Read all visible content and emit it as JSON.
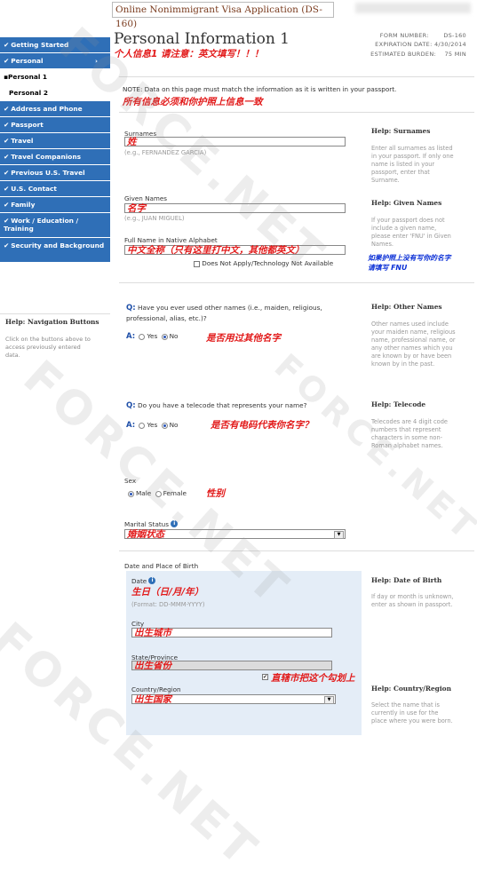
{
  "app_title": "Online Nonimmigrant Visa Application (DS-160)",
  "page_title": "Personal Information 1",
  "form_meta": {
    "form_number_label": "FORM NUMBER:",
    "form_number": "DS-160",
    "expiration_label": "EXPIRATION DATE:",
    "expiration": "4/30/2014",
    "burden_label": "ESTIMATED BURDEN:",
    "burden": "75 MIN"
  },
  "sidebar": {
    "items": [
      {
        "label": "Getting Started"
      },
      {
        "label": "Personal",
        "arrow": "›"
      },
      {
        "label": "Personal 1"
      },
      {
        "label": "Personal 2"
      },
      {
        "label": "Address and Phone"
      },
      {
        "label": "Passport"
      },
      {
        "label": "Travel"
      },
      {
        "label": "Travel Companions"
      },
      {
        "label": "Previous U.S. Travel"
      },
      {
        "label": "U.S. Contact"
      },
      {
        "label": "Family"
      },
      {
        "label": "Work / Education / Training"
      },
      {
        "label": "Security and Background"
      }
    ],
    "help_title": "Help: Navigation Buttons",
    "help_text": "Click on the buttons above to access previously entered data."
  },
  "annotations": {
    "title_note": "个人信息1 请注意：英文填写！！！",
    "passport_note": "所有信息必须和你护照上信息一致",
    "surname": "姓",
    "given": "名字",
    "native": "中文全称（只有这里打中文，其他都英文）",
    "fnu_note_1": "如果护照上没有写你的名字",
    "fnu_note_2": "请填写 FNU",
    "other_names": "是否用过其他名字",
    "telecode": "是否有电码代表你名字？",
    "sex": "性别",
    "marital": "婚姻状态",
    "dob": "生日（日/月/年）",
    "city": "出生城市",
    "state": "出生省份",
    "state_check": "直辖市把这个勾划上",
    "country": "出生国家"
  },
  "note": "NOTE: Data on this page must match the information as it is written in your passport.",
  "fields": {
    "surnames_label": "Surnames",
    "surnames_hint": "(e.g., FERNANDEZ GARCIA)",
    "given_label": "Given Names",
    "given_hint": "(e.g., JUAN MIGUEL)",
    "native_label": "Full Name in Native Alphabet",
    "native_na": "Does Not Apply/Technology Not Available",
    "q_other": "Have you ever used other names (i.e., maiden, religious, professional, alias, etc.)?",
    "q_telecode": "Do you have a telecode that represents your name?",
    "q_prefix": "Q:",
    "a_prefix": "A:",
    "yes": "Yes",
    "no": "No",
    "sex_label": "Sex",
    "male": "Male",
    "female": "Female",
    "marital_label": "Marital Status",
    "dob_title": "Date and Place of Birth",
    "date_label": "Date",
    "date_format": "(Format: DD-MMM-YYYY)",
    "city_label": "City",
    "state_label": "State/Province",
    "country_label": "Country/Region"
  },
  "help": {
    "surnames_title": "Help: Surnames",
    "surnames_text": "Enter all surnames as listed in your passport. If only one name is listed in your passport, enter that Surname.",
    "given_title": "Help: Given Names",
    "given_text": "If your passport does not include a given name, please enter 'FNU' in Given Names.",
    "other_title": "Help: Other Names",
    "other_text": "Other names used include your maiden name, religious name, professional name, or any other names which you are known by or have been known by in the past.",
    "telecode_title": "Help: Telecode",
    "telecode_text": "Telecodes are 4 digit code numbers that represent characters in some non-Roman alphabet names.",
    "dob_title": "Help: Date of Birth",
    "dob_text": "If day or month is unknown, enter as shown in passport.",
    "country_title": "Help: Country/Region",
    "country_text": "Select the name that is currently in use for the place where you were born."
  },
  "watermark": "FORCE.NET"
}
